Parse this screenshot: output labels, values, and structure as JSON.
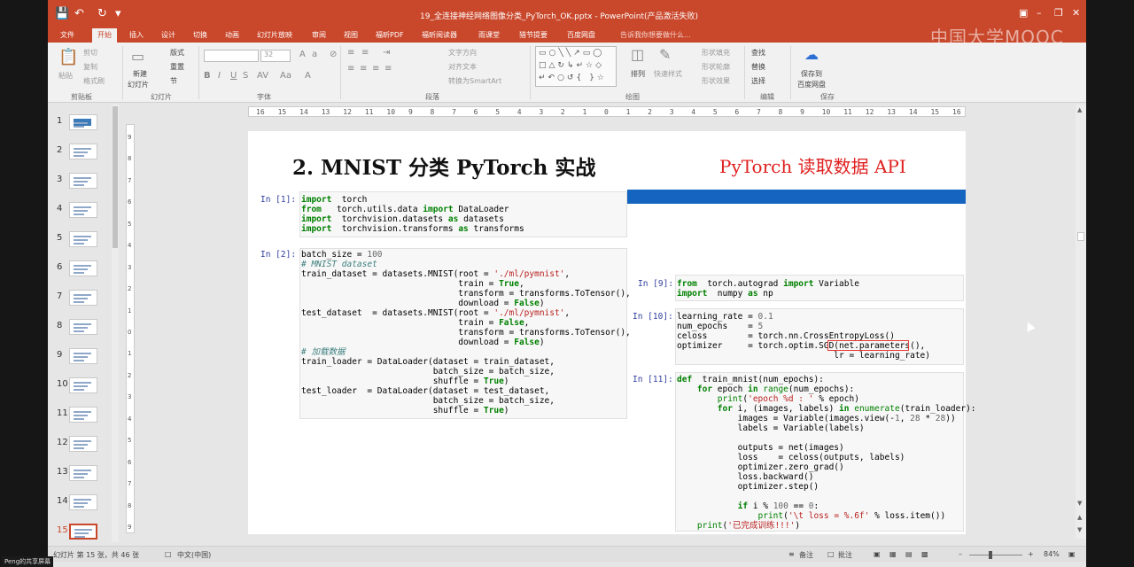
{
  "window": {
    "title": "19_全连接神经网络图像分类_PyTorch_OK.pptx - PowerPoint(产品激活失败)",
    "quick_access": [
      "save-icon",
      "undo-icon",
      "redo-icon",
      "customize-icon"
    ],
    "controls": [
      "ribbon-options-icon",
      "minimize-icon",
      "restore-icon",
      "close-icon"
    ]
  },
  "tabs": [
    "文件",
    "开始",
    "插入",
    "设计",
    "切换",
    "动画",
    "幻灯片放映",
    "审阅",
    "视图",
    "福昕PDF",
    "福昕阅读器",
    "雨课堂",
    "猎节提要",
    "百度网盘"
  ],
  "tell_me": "告诉我你想要做什么...",
  "watermark": "中国大学MOOC",
  "ribbon": {
    "clipboard": {
      "paste": "粘贴",
      "cut": "剪切",
      "copy": "复制",
      "format_painter": "格式刷",
      "group": "剪贴板"
    },
    "slides": {
      "new_slide": "新建",
      "new_slide2": "幻灯片",
      "layout": "版式",
      "reset": "重置",
      "section": "节",
      "group": "幻灯片"
    },
    "font": {
      "name": "",
      "size": "32",
      "group": "字体"
    },
    "paragraph": {
      "text_direction": "文字方向",
      "align_text": "对齐文本",
      "smartart": "转换为SmartArt",
      "group": "段落"
    },
    "drawing": {
      "arrange": "排列",
      "quick_styles": "快速样式",
      "shape_fill": "形状填充",
      "shape_outline": "形状轮廓",
      "shape_effects": "形状效果",
      "group": "绘图"
    },
    "editing": {
      "find": "查找",
      "replace": "替换",
      "select": "选择",
      "group": "编辑"
    },
    "save": {
      "label1": "保存到",
      "label2": "百度网盘",
      "group": "保存"
    }
  },
  "thumbnails": [
    1,
    2,
    3,
    4,
    5,
    6,
    7,
    8,
    9,
    10,
    11,
    12,
    13,
    14,
    15
  ],
  "selected_slide": 15,
  "ruler_h": [
    "16",
    "15",
    "14",
    "13",
    "12",
    "11",
    "10",
    "9",
    "8",
    "7",
    "6",
    "5",
    "4",
    "3",
    "2",
    "1",
    "0",
    "1",
    "2",
    "3",
    "4",
    "5",
    "6",
    "7",
    "8",
    "9",
    "10",
    "11",
    "12",
    "13",
    "14",
    "15",
    "16"
  ],
  "ruler_v": [
    "9",
    "8",
    "7",
    "6",
    "5",
    "4",
    "3",
    "2",
    "1",
    "0",
    "1",
    "2",
    "3",
    "4",
    "5",
    "6",
    "7",
    "8",
    "9"
  ],
  "slide": {
    "title": "2.  MNIST 分类 PyTorch 实战",
    "subtitle": "PyTorch 读取数据 API",
    "cells": [
      {
        "prompt": "In [1]:",
        "lines": [
          [
            [
              "kw",
              "import"
            ],
            [
              "",
              "  torch"
            ]
          ],
          [
            [
              "kw",
              "from"
            ],
            [
              "",
              "   torch.utils.data "
            ],
            [
              "kw",
              "import"
            ],
            [
              "",
              " DataLoader"
            ]
          ],
          [
            [
              "kw",
              "import"
            ],
            [
              "",
              "  torchvision.datasets "
            ],
            [
              "kw",
              "as"
            ],
            [
              "",
              " datasets"
            ]
          ],
          [
            [
              "kw",
              "import"
            ],
            [
              "",
              "  torchvision.transforms "
            ],
            [
              "kw",
              "as"
            ],
            [
              "",
              " transforms"
            ]
          ]
        ]
      },
      {
        "prompt": "In [2]:",
        "lines": [
          [
            [
              "",
              "batch_size = "
            ],
            [
              "nu",
              "100"
            ]
          ],
          [
            [
              "cm",
              "# MNIST dataset"
            ]
          ],
          [
            [
              "",
              "train_dataset = datasets.MNIST(root = "
            ],
            [
              "st",
              "'./ml/pymnist'"
            ],
            [
              "",
              ","
            ]
          ],
          [
            [
              "",
              "                               train = "
            ],
            [
              "kw",
              "True"
            ],
            [
              "",
              ","
            ]
          ],
          [
            [
              "",
              "                               transform = transforms.ToTensor(),"
            ]
          ],
          [
            [
              "",
              "                               download = "
            ],
            [
              "kw",
              "False"
            ],
            [
              "",
              ")"
            ]
          ],
          [
            [
              "",
              "test_dataset  = datasets.MNIST(root = "
            ],
            [
              "st",
              "'./ml/pymnist'"
            ],
            [
              "",
              ","
            ]
          ],
          [
            [
              "",
              "                               train = "
            ],
            [
              "kw",
              "False"
            ],
            [
              "",
              ","
            ]
          ],
          [
            [
              "",
              "                               transform = transforms.ToTensor(),"
            ]
          ],
          [
            [
              "",
              "                               download = "
            ],
            [
              "kw",
              "False"
            ],
            [
              "",
              ")"
            ]
          ],
          [
            [
              "cm",
              "# 加载数据"
            ]
          ],
          [
            [
              "",
              "train_loader = DataLoader(dataset = train_dataset,"
            ]
          ],
          [
            [
              "",
              "                          batch_size = batch_size,"
            ]
          ],
          [
            [
              "",
              "                          shuffle = "
            ],
            [
              "kw",
              "True"
            ],
            [
              "",
              ")"
            ]
          ],
          [
            [
              "",
              "test_loader  = DataLoader(dataset = test_dataset,"
            ]
          ],
          [
            [
              "",
              "                          batch_size = batch_size,"
            ]
          ],
          [
            [
              "",
              "                          shuffle = "
            ],
            [
              "kw",
              "True"
            ],
            [
              "",
              ")"
            ]
          ]
        ]
      },
      {
        "prompt": "In [9]:",
        "lines": [
          [
            [
              "kw",
              "from"
            ],
            [
              "",
              "  torch.autograd "
            ],
            [
              "kw",
              "import"
            ],
            [
              "",
              " Variable"
            ]
          ],
          [
            [
              "kw",
              "import"
            ],
            [
              "",
              "  numpy "
            ],
            [
              "kw",
              "as"
            ],
            [
              "",
              " np"
            ]
          ]
        ]
      },
      {
        "prompt": "In [10]:",
        "lines": [
          [
            [
              "",
              "learning_rate = "
            ],
            [
              "nu",
              "0.1"
            ]
          ],
          [
            [
              "",
              "num_epochs    = "
            ],
            [
              "nu",
              "5"
            ]
          ],
          [
            [
              "",
              "celoss        = torch.nn.CrossEntropyLoss()"
            ]
          ],
          [
            [
              "",
              "optimizer     = torch.optim.SGD(net.parameters(),"
            ]
          ],
          [
            [
              "",
              "                               lr = learning_rate)"
            ]
          ]
        ]
      },
      {
        "prompt": "In [11]:",
        "lines": [
          [
            [
              "kw",
              "def"
            ],
            [
              "",
              "  train_mnist(num_epochs):"
            ]
          ],
          [
            [
              "",
              "    "
            ],
            [
              "kw",
              "for"
            ],
            [
              "",
              " epoch "
            ],
            [
              "kw",
              "in"
            ],
            [
              "",
              " "
            ],
            [
              "bi",
              "range"
            ],
            [
              "",
              "(num_epochs):"
            ]
          ],
          [
            [
              "",
              "        "
            ],
            [
              "bi",
              "print"
            ],
            [
              "",
              "("
            ],
            [
              "st",
              "'epoch %d : '"
            ],
            [
              "",
              " % epoch)"
            ]
          ],
          [
            [
              "",
              "        "
            ],
            [
              "kw",
              "for"
            ],
            [
              "",
              " i, (images, labels) "
            ],
            [
              "kw",
              "in"
            ],
            [
              "",
              " "
            ],
            [
              "bi",
              "enumerate"
            ],
            [
              "",
              "(train_loader):"
            ]
          ],
          [
            [
              "",
              "            images = Variable(images.view(-"
            ],
            [
              "nu",
              "1"
            ],
            [
              "",
              ", "
            ],
            [
              "nu",
              "28"
            ],
            [
              "",
              " * "
            ],
            [
              "nu",
              "28"
            ],
            [
              "",
              "))"
            ]
          ],
          [
            [
              "",
              "            labels = Variable(labels)"
            ]
          ],
          [
            [
              "",
              ""
            ]
          ],
          [
            [
              "",
              "            outputs = net(images)"
            ]
          ],
          [
            [
              "",
              "            loss    = celoss(outputs, labels)"
            ]
          ],
          [
            [
              "",
              "            optimizer.zero_grad()"
            ]
          ],
          [
            [
              "",
              "            loss.backward()"
            ]
          ],
          [
            [
              "",
              "            optimizer.step()"
            ]
          ],
          [
            [
              "",
              ""
            ]
          ],
          [
            [
              "",
              "            "
            ],
            [
              "kw",
              "if"
            ],
            [
              "",
              " i % "
            ],
            [
              "nu",
              "100"
            ],
            [
              "",
              " == "
            ],
            [
              "nu",
              "0"
            ],
            [
              "",
              ":"
            ]
          ],
          [
            [
              "",
              "                "
            ],
            [
              "bi",
              "print"
            ],
            [
              "",
              "("
            ],
            [
              "st",
              "'\\t loss = %.6f'"
            ],
            [
              "",
              " % loss.item())"
            ]
          ],
          [
            [
              "",
              "    "
            ],
            [
              "bi",
              "print"
            ],
            [
              "",
              "("
            ],
            [
              "st",
              "'已完成训练!!!'"
            ],
            [
              "",
              ")"
            ]
          ]
        ]
      }
    ]
  },
  "status": {
    "slide_info": "幻灯片 第 15 张，共 46 张",
    "language": "中文(中国)",
    "notes": "备注",
    "comments": "批注",
    "zoom": "84%"
  },
  "share_badge": "Peng的共享屏幕",
  "colors": {
    "accent": "#c9472b",
    "prompt": "#303f9f",
    "keyword": "#008000",
    "string": "#ba2121",
    "highlight": "#e53935",
    "bluebar": "#1565c0"
  }
}
